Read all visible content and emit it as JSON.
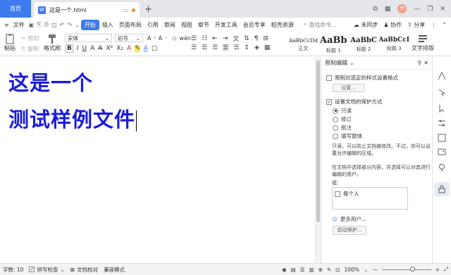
{
  "titlebar": {
    "home_tab": "首页",
    "doc_tab": "这是一个.html",
    "doc_icon_text": "W",
    "avatar_text": "HP"
  },
  "menubar": {
    "file_label": "文件",
    "tabs": [
      "开始",
      "插入",
      "页面布局",
      "引用",
      "审阅",
      "视图",
      "章节",
      "开发工具",
      "会员专享",
      "稻壳资源"
    ],
    "search_placeholder": "查找命令...",
    "sync_label": "未同步",
    "collab_label": "协作",
    "share_label": "分享"
  },
  "toolbar": {
    "paste_label": "粘贴",
    "cut_label": "剪切",
    "copy_label": "复制",
    "format_painter_label": "格式刷",
    "font_name": "宋体",
    "font_size": "初号",
    "styles": [
      {
        "preview": "AaBbCcDd",
        "label": "正文"
      },
      {
        "preview": "AaBb",
        "label": "标题 1"
      },
      {
        "preview": "AaBbC",
        "label": "标题 2"
      },
      {
        "preview": "AaBbCcI",
        "label": "标题 3"
      }
    ],
    "text_layout_label": "文字排版"
  },
  "document": {
    "lines": [
      "这是一个",
      "测试样例文件"
    ]
  },
  "panel": {
    "title": "限制编辑",
    "restrict_format_label": "限制对选定的样式设置格式",
    "settings_button": "设置...",
    "protect_label": "设置文档的保护方式",
    "options": [
      "只读",
      "修订",
      "批注",
      "填写窗体"
    ],
    "selected_option": "只读",
    "readonly_desc": "只读，可以防止文档被修改。不过，你可以设置允许编辑的区域。",
    "select_desc": "在文档中选择部分内容，并选择可以对其进行编辑的用户。",
    "group_label": "组：",
    "everyone_label": "每个人",
    "more_users": "更多用户...",
    "start_protect_button": "启动保护..."
  },
  "statusbar": {
    "word_count": "字数: 10",
    "spell_check": "拼写检查",
    "proofread": "文档校对",
    "compat_mode": "兼容模式",
    "zoom": "100%"
  },
  "colors": {
    "accent": "#3e7bef",
    "doc_text": "#1c1cd8"
  }
}
